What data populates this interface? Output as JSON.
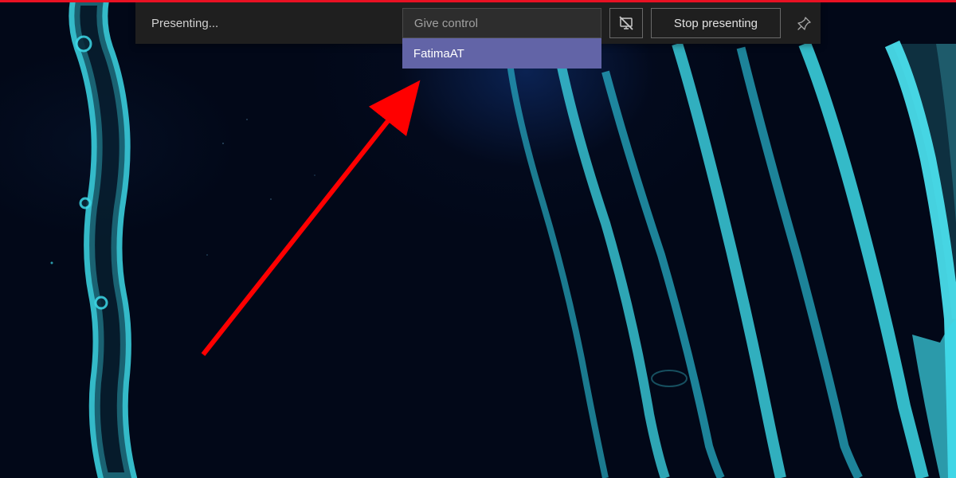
{
  "toolbar": {
    "presenting_label": "Presenting...",
    "give_control_label": "Give control",
    "give_control_options": [
      {
        "label": "FatimaAT"
      }
    ],
    "stop_presenting_label": "Stop presenting"
  },
  "colors": {
    "accent_red": "#e81123",
    "toolbar_bg": "#1f1f1f",
    "dropdown_selected": "#6264a7",
    "annotation_arrow": "#ff0000"
  }
}
